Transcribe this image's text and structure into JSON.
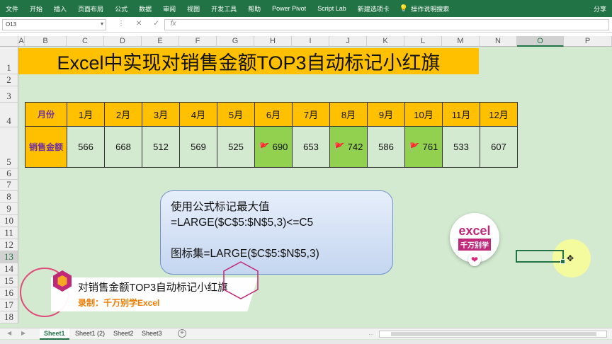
{
  "ribbon": {
    "tabs": [
      "文件",
      "开始",
      "插入",
      "页面布局",
      "公式",
      "数据",
      "审阅",
      "视图",
      "开发工具",
      "帮助",
      "Power Pivot",
      "Script Lab",
      "新建选项卡"
    ],
    "tell_me": "操作说明搜索",
    "right_partial": "分享"
  },
  "formula_bar": {
    "name_box": "O13",
    "dropdown": "▾",
    "icons": [
      "⋮",
      "✕",
      "✓",
      "fx"
    ],
    "formula": ""
  },
  "columns": [
    "A",
    "B",
    "C",
    "D",
    "E",
    "F",
    "G",
    "H",
    "I",
    "J",
    "K",
    "L",
    "M",
    "N",
    "O",
    "P"
  ],
  "selected_column": "O",
  "rows": [
    "1",
    "2",
    "3",
    "4",
    "5",
    "6",
    "7",
    "8",
    "9",
    "10",
    "11",
    "12",
    "13",
    "14",
    "15",
    "16",
    "17",
    "18"
  ],
  "selected_row": "13",
  "title": "Excel中实现对销售金额TOP3自动标记小红旗",
  "table": {
    "row_label_month": "月份",
    "row_label_sales": "销售金额",
    "months": [
      "1月",
      "2月",
      "3月",
      "4月",
      "5月",
      "6月",
      "7月",
      "8月",
      "9月",
      "10月",
      "11月",
      "12月"
    ],
    "sales": [
      "566",
      "668",
      "512",
      "569",
      "525",
      "690",
      "653",
      "742",
      "586",
      "761",
      "533",
      "607"
    ],
    "flag_glyph": "🚩",
    "top3_color": "#92d050",
    "header_color": "#ffc000"
  },
  "note": {
    "line1": "使用公式标记最大值",
    "line2": "=LARGE($C$5:$N$5,3)<=C5",
    "line3": "图标集=LARGE($C$5:$N$5,3)"
  },
  "logo": {
    "line1": "excel",
    "line2": "千万别学",
    "heart": "❤"
  },
  "banner": {
    "title": "对销售金额TOP3自动标记小红旗",
    "subtitle": "录制：千万别学Excel"
  },
  "sheets": {
    "tabs": [
      "Sheet1",
      "Sheet1 (2)",
      "Sheet2",
      "Sheet3"
    ],
    "active": "Sheet1",
    "add": "+",
    "nav_left": "◀",
    "nav_right": "▶",
    "more_left": "…"
  },
  "cursor": "✥"
}
